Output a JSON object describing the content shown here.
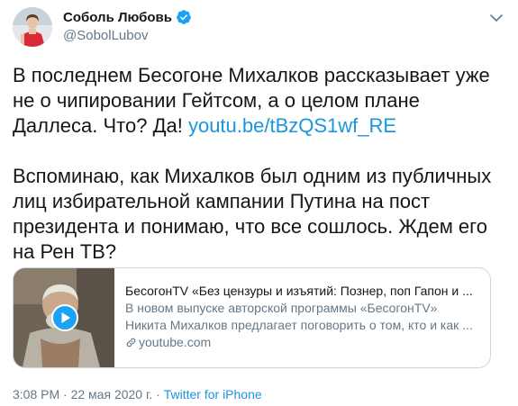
{
  "author": {
    "display_name": "Соболь Любовь",
    "handle": "@SobolLubov",
    "verified_icon": "verified-badge-icon",
    "accent": "#1da1f2"
  },
  "tweet": {
    "para1_text": "В последнем Бесогоне Михалков рассказывает уже не о чипировании Гейтсом, а о целом плане Даллеса. Что? Да! ",
    "para1_link": "youtu.be/tBzQS1wf_RE",
    "para2_text": "Вспоминаю, как Михалков был одним из публичных лиц избирательной кампании Путина на пост президента и понимаю, что все сошлось. Ждем его на Рен ТВ?"
  },
  "card": {
    "title": "БесогонTV «Без цензуры и изъятий: Познер, поп Гапон и ...",
    "description": "В новом выпуске авторской программы «БесогонTV» Никита Михалков предлагает поговорить о том, кто и как ...",
    "domain": "youtube.com",
    "play_icon": "play-button-icon"
  },
  "footer": {
    "time": "3:08 PM",
    "separator1": " · ",
    "date": "22 мая 2020 г.",
    "separator2": " · ",
    "source": "Twitter for iPhone"
  },
  "colors": {
    "link": "#1b95e0",
    "secondary_text": "#657786",
    "border": "#ccd6dd"
  }
}
